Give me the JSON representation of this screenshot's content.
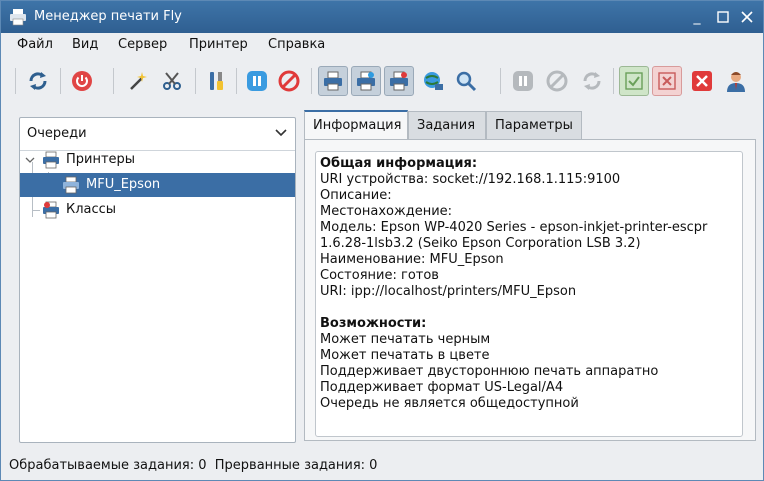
{
  "window": {
    "title": "Менеджер печати Fly"
  },
  "menu": [
    "Файл",
    "Вид",
    "Сервер",
    "Принтер",
    "Справка"
  ],
  "toolbar": {
    "icons": [
      "refresh-icon",
      "power-icon",
      "wizard-wand-icon",
      "scissors-icon",
      "tools-icon",
      "pause-icon",
      "stop-icon",
      "printer-icon",
      "printer-pressed-icon",
      "printer-warning-icon",
      "network-printer-icon",
      "search-icon",
      "pause-disabled-icon",
      "stop-disabled-icon",
      "refresh-disabled-icon",
      "checkbox-checked-icon",
      "checkbox-x-icon",
      "red-x-icon",
      "user-icon"
    ]
  },
  "queues": {
    "combo_label": "Очереди",
    "printers_label": "Принтеры",
    "selected_printer": "MFU_Epson",
    "classes_label": "Классы"
  },
  "tabs": [
    "Информация",
    "Задания",
    "Параметры"
  ],
  "info": {
    "general_heading": "Общая информация:",
    "lines": [
      "URI устройства: socket://192.168.1.115:9100",
      "Описание:",
      "Местонахождение:",
      "Модель: Epson WP-4020 Series - epson-inkjet-printer-escpr",
      "1.6.28-1lsb3.2 (Seiko Epson Corporation LSB 3.2)",
      "Наименование: MFU_Epson",
      "Состояние: готов",
      "URI: ipp://localhost/printers/MFU_Epson"
    ],
    "capabilities_heading": "Возможности:",
    "capabilities": [
      "Может печатать черным",
      "Может печатать в цвете",
      "Поддерживает двустороннюю печать аппаратно",
      "Поддерживает формат US-Legal/A4",
      "Очередь не является общедоступной"
    ]
  },
  "status": {
    "text": "Обрабатываемые задания: 0  Прерванные задания: 0"
  }
}
